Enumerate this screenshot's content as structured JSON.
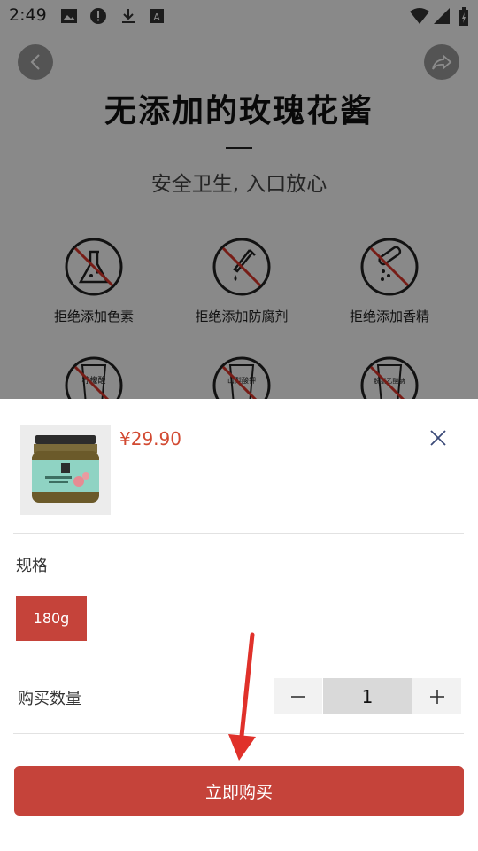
{
  "status_bar": {
    "time": "2:49",
    "icons": [
      "image-icon",
      "alert-icon",
      "download-icon",
      "a-badge-icon",
      "wifi-icon",
      "signal-icon",
      "battery-icon"
    ]
  },
  "background_page": {
    "title": "无添加的玫瑰花酱",
    "subtitle": "安全卫生, 入口放心",
    "features": [
      {
        "label": "拒绝添加色素",
        "icon": "no-colorant-icon"
      },
      {
        "label": "拒绝添加防腐剂",
        "icon": "no-preservative-icon"
      },
      {
        "label": "拒绝添加香精",
        "icon": "no-flavoring-icon"
      }
    ],
    "second_row_icon_texts": [
      "柠檬酸",
      "山梨酸钾",
      "脱氢乙酸钠"
    ]
  },
  "sheet": {
    "price": "¥29.90",
    "spec_label": "规格",
    "spec_options": [
      {
        "label": "180g",
        "selected": true
      }
    ],
    "quantity_label": "购买数量",
    "quantity": "1",
    "buy_label": "立即购买"
  },
  "colors": {
    "accent": "#c5433a",
    "price": "#d24a32",
    "overlay": "rgba(0,0,0,0.45)"
  }
}
